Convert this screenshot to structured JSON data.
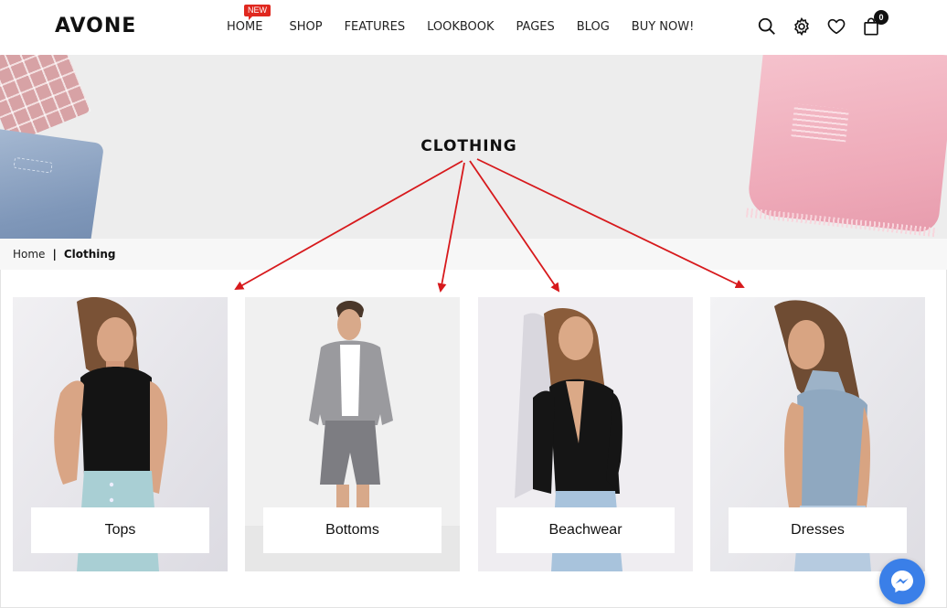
{
  "header": {
    "logo": "AVONE",
    "nav": [
      {
        "label": "HOME",
        "badge": "NEW"
      },
      {
        "label": "SHOP"
      },
      {
        "label": "FEATURES"
      },
      {
        "label": "LOOKBOOK"
      },
      {
        "label": "PAGES"
      },
      {
        "label": "BLOG"
      },
      {
        "label": "BUY NOW!"
      }
    ],
    "icons": [
      "search-icon",
      "settings-icon",
      "wishlist-heart-icon",
      "shopping-bag-icon"
    ],
    "cart_count": "0"
  },
  "banner": {
    "title": "CLOTHING"
  },
  "breadcrumb": {
    "home": "Home",
    "separator": "|",
    "current": "Clothing"
  },
  "categories": [
    {
      "label": "Tops"
    },
    {
      "label": "Bottoms"
    },
    {
      "label": "Beachwear"
    },
    {
      "label": "Dresses"
    }
  ],
  "colors": {
    "annotation_arrow": "#d7191c",
    "badge": "#e0281f",
    "messenger": "#3a7fe8"
  },
  "chat": {
    "icon": "messenger-icon"
  }
}
